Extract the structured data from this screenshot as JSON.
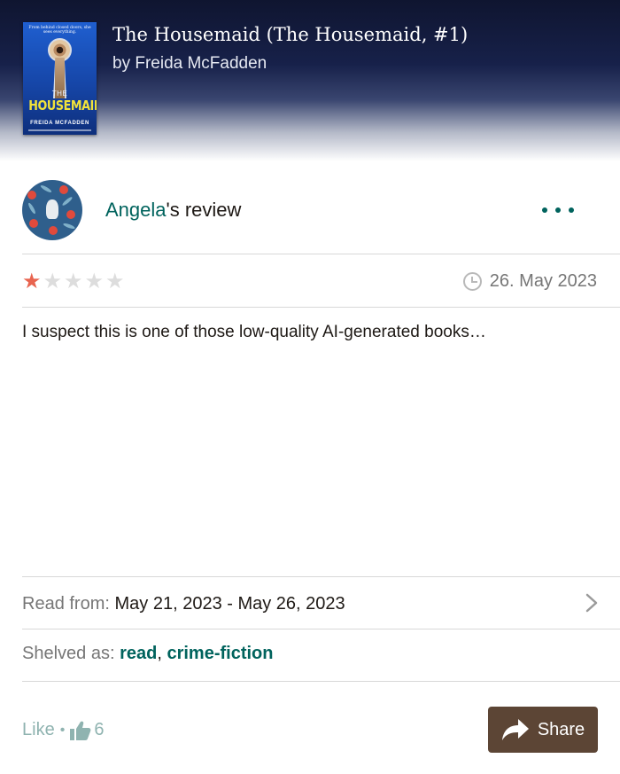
{
  "book": {
    "title": "The Housemaid (The Housemaid, #1)",
    "author": "by Freida McFadden",
    "cover": {
      "tagline": "From behind closed doors, she sees everything.",
      "the": "THE",
      "title": "HOUSEMAID",
      "author": "FREIDA MCFADDEN"
    }
  },
  "review": {
    "reviewer_name": "Angela",
    "reviewer_suffix": "'s review",
    "rating": 1,
    "rating_max": 5,
    "date": "26. May 2023",
    "text": "I suspect this is one of those low-quality AI-generated books…",
    "read_from_label": "Read from:",
    "read_from_value": "May 21, 2023 - May 26, 2023",
    "shelved_label": "Shelved as:",
    "shelves": [
      "read",
      "crime-fiction"
    ],
    "shelf_separator": ", ",
    "like_label": "Like",
    "like_separator": "•",
    "like_count": "6",
    "share_label": "Share"
  },
  "icons": {
    "more": "more-horizontal-icon",
    "clock": "clock-icon",
    "chevron": "chevron-right-icon",
    "thumb": "thumbs-up-icon",
    "share": "share-arrow-icon"
  },
  "colors": {
    "accent_green": "#00635d",
    "star_on": "#e8644f",
    "star_off": "#dddddd",
    "share_button": "#5c4535",
    "header_dark": "#0f1530"
  }
}
